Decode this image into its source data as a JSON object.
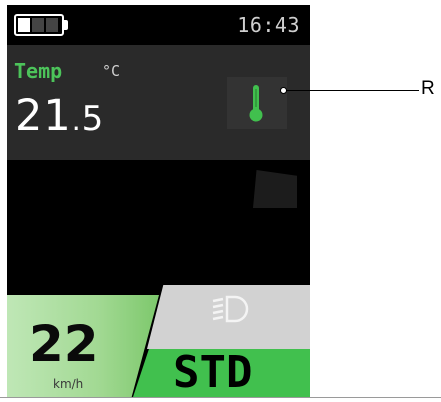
{
  "status": {
    "time": "16:43",
    "battery_level": 0.33,
    "battery_segments": 3
  },
  "temperature": {
    "label": "Temp",
    "unit": "°C",
    "value_int": "21",
    "value_dec": "5"
  },
  "speed": {
    "value": "22",
    "unit": "km/h"
  },
  "mode": {
    "label": "STD"
  },
  "callout": {
    "label": "R"
  },
  "colors": {
    "accent": "#41c04e",
    "panel": "#2a2a2a",
    "speed_bg": "#a2d993",
    "light_bg": "#d2d2d2"
  }
}
